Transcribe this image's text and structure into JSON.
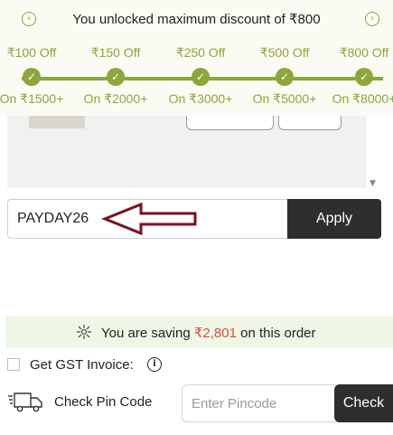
{
  "banner": {
    "title": "You unlocked maximum discount of ₹800",
    "prev_icon": "chevron-left-icon",
    "next_icon": "chevron-right-icon",
    "accent_color": "#8ba63a",
    "tiers": [
      {
        "amount": "₹100 Off",
        "condition": "On ₹1500+",
        "unlocked": true
      },
      {
        "amount": "₹150 Off",
        "condition": "On ₹2000+",
        "unlocked": true
      },
      {
        "amount": "₹250 Off",
        "condition": "On ₹3000+",
        "unlocked": true
      },
      {
        "amount": "₹500 Off",
        "condition": "On ₹5000+",
        "unlocked": true
      },
      {
        "amount": "₹800 Off",
        "condition": "On ₹8000+",
        "unlocked": true
      }
    ]
  },
  "coupon": {
    "value": "PAYDAY26",
    "apply_label": "Apply",
    "annotation_color": "#7a1020"
  },
  "savings": {
    "prefix": "You are saving",
    "amount": "₹2,801",
    "suffix": "on this order",
    "amount_color": "#e04b3a",
    "background": "#eef7e6"
  },
  "gst": {
    "label": "Get GST Invoice:",
    "checked": false
  },
  "pincode": {
    "label": "Check Pin Code",
    "placeholder": "Enter Pincode",
    "button_label": "Check"
  }
}
